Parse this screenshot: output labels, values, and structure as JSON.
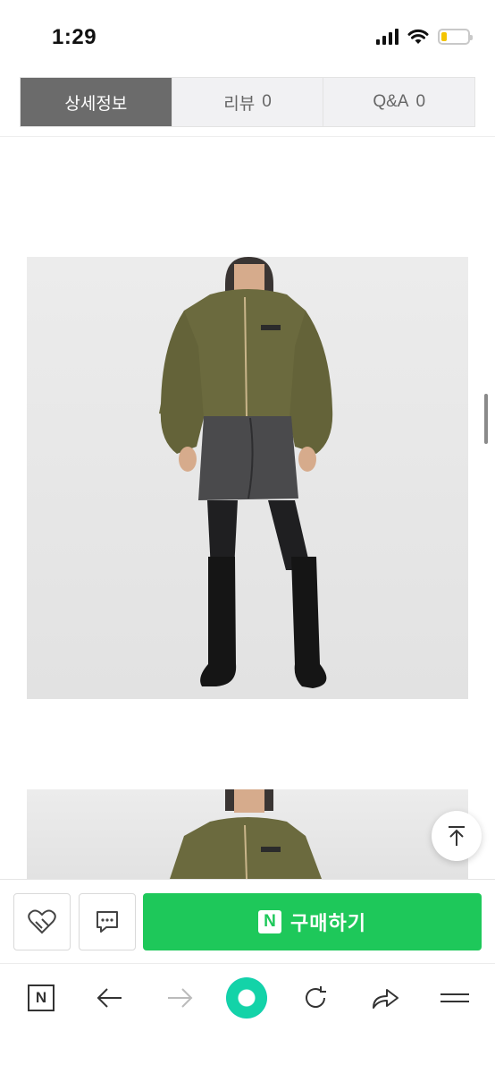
{
  "status_bar": {
    "time": "1:29",
    "icons": [
      "signal-icon",
      "wifi-icon",
      "battery-icon"
    ],
    "battery_level": 0.2,
    "battery_color": "#f4c400"
  },
  "tabs": [
    {
      "label": "상세정보",
      "count": "",
      "active": true
    },
    {
      "label": "리뷰",
      "count": "0",
      "active": false
    },
    {
      "label": "Q&A",
      "count": "0",
      "active": false
    }
  ],
  "product_images": [
    {
      "icon": "model-photo-full"
    },
    {
      "icon": "model-photo-cropped"
    }
  ],
  "purchase_bar": {
    "buy_label": "구매하기",
    "naver_badge": "N",
    "buy_color": "#1ec85a",
    "icons": [
      "heart-plus-icon",
      "chat-icon"
    ]
  },
  "browser_toolbar": {
    "home_label": "N",
    "icons": [
      "naver-home-icon",
      "back-arrow-icon",
      "forward-arrow-icon",
      "green-dot-icon",
      "reload-icon",
      "share-icon",
      "menu-icon"
    ]
  }
}
